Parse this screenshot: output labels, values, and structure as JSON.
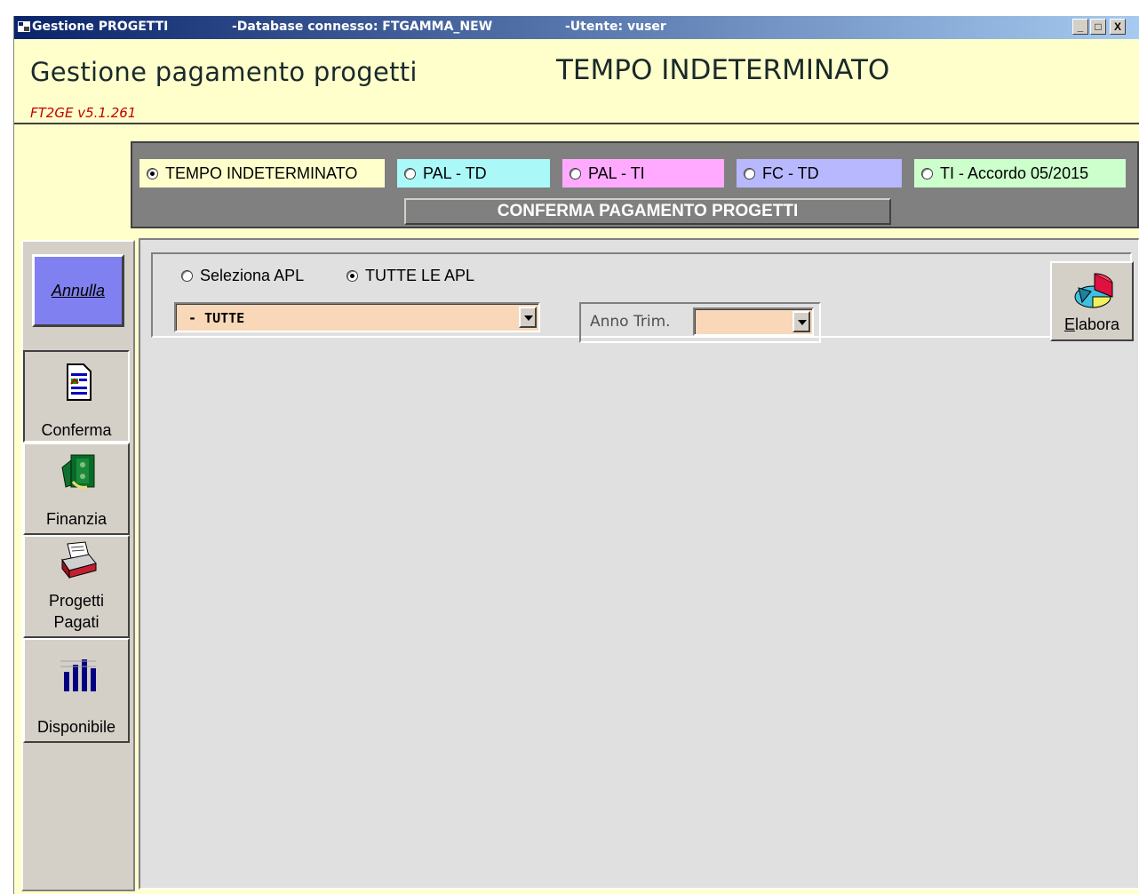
{
  "window": {
    "title_app": "Gestione PROGETTI",
    "title_db": "-Database connesso: FTGAMMA_NEW",
    "title_user": "-Utente: vuser",
    "controls": {
      "minimize": "_",
      "maximize": "□",
      "close": "X"
    }
  },
  "header": {
    "title": "Gestione pagamento progetti",
    "type": "TEMPO INDETERMINATO",
    "version": "FT2GE v5.1.261"
  },
  "contract_types": [
    {
      "label": "TEMPO INDETERMINATO",
      "selected": true,
      "color": "#ffffcc"
    },
    {
      "label": "PAL - TD",
      "selected": false,
      "color": "#aaf8f8"
    },
    {
      "label": "PAL - TI",
      "selected": false,
      "color": "#ffaaff"
    },
    {
      "label": "FC - TD",
      "selected": false,
      "color": "#b8b8ff"
    },
    {
      "label": "TI - Accordo 05/2015",
      "selected": false,
      "color": "#ccffcc"
    }
  ],
  "confirm_bar": "CONFERMA PAGAMENTO PROGETTI",
  "sidebar": {
    "annulla": "Annulla",
    "items": [
      {
        "label": "Conferma",
        "icon": "document-icon",
        "active": true
      },
      {
        "label": "Finanzia",
        "icon": "money-icon",
        "active": false
      },
      {
        "label": "Progetti Pagati",
        "icon": "printer-icon",
        "active": false
      },
      {
        "label": "Disponibile",
        "icon": "bar-chart-icon",
        "active": false
      }
    ]
  },
  "filters": {
    "apl_select": "Seleziona APL",
    "apl_all": "TUTTE LE APL",
    "apl_all_selected": true,
    "apl_combo_value": "- TUTTE",
    "anno_label": "Anno Trim.",
    "anno_value": ""
  },
  "elabora": {
    "label": "Elabora",
    "icon": "pie-chart-icon"
  }
}
